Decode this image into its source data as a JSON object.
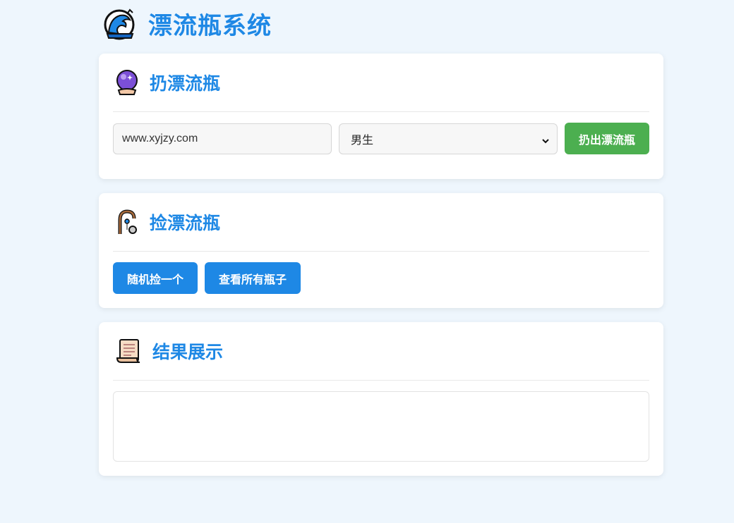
{
  "header": {
    "title": "漂流瓶系统",
    "icon": "wave-icon"
  },
  "throw_section": {
    "title": "扔漂流瓶",
    "icon": "crystal-ball-icon",
    "input_value": "www.xyjzy.com",
    "gender_selected": "男生",
    "submit_label": "扔出漂流瓶"
  },
  "pick_section": {
    "title": "捡漂流瓶",
    "icon": "fishing-pole-icon",
    "random_label": "随机捡一个",
    "view_all_label": "查看所有瓶子"
  },
  "result_section": {
    "title": "结果展示",
    "icon": "scroll-icon",
    "content": ""
  },
  "colors": {
    "accent": "#1e88e5",
    "green": "#4caf50",
    "background": "#eef6fd"
  }
}
